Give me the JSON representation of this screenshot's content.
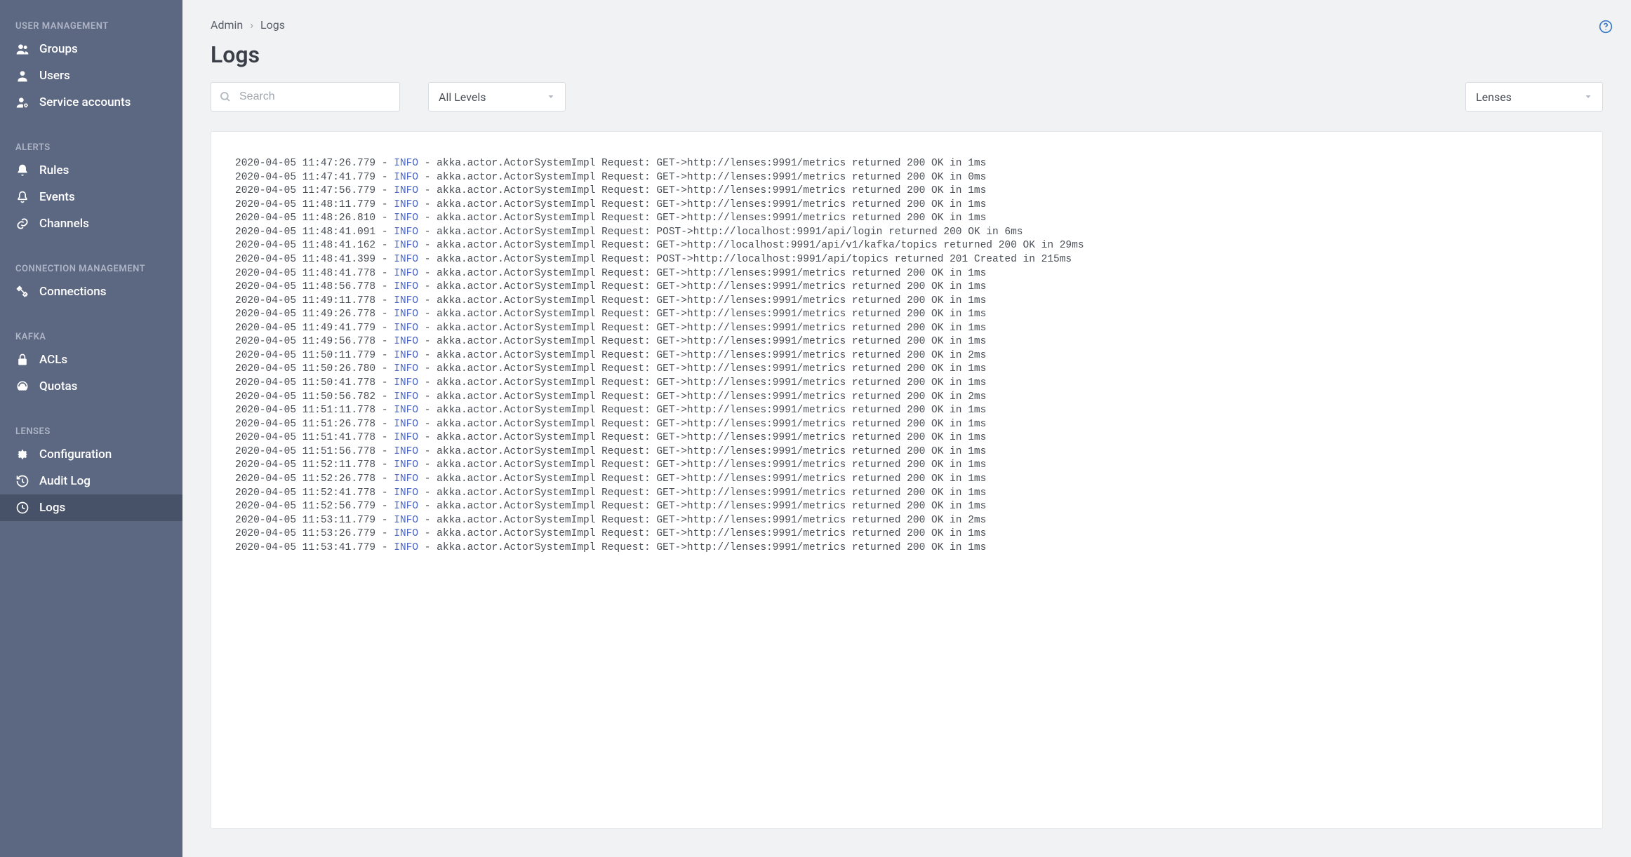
{
  "sidebar": {
    "sections": [
      {
        "title": "USER MANAGEMENT",
        "items": [
          {
            "label": "Groups",
            "icon": "users-icon"
          },
          {
            "label": "Users",
            "icon": "user-icon"
          },
          {
            "label": "Service accounts",
            "icon": "user-gear-icon"
          }
        ]
      },
      {
        "title": "ALERTS",
        "items": [
          {
            "label": "Rules",
            "icon": "bell-solid-icon"
          },
          {
            "label": "Events",
            "icon": "bell-outline-icon"
          },
          {
            "label": "Channels",
            "icon": "link-icon"
          }
        ]
      },
      {
        "title": "CONNECTION MANAGEMENT",
        "items": [
          {
            "label": "Connections",
            "icon": "plug-icon"
          }
        ]
      },
      {
        "title": "KAFKA",
        "items": [
          {
            "label": "ACLs",
            "icon": "lock-icon"
          },
          {
            "label": "Quotas",
            "icon": "dashboard-icon"
          }
        ]
      },
      {
        "title": "LENSES",
        "items": [
          {
            "label": "Configuration",
            "icon": "gear-icon"
          },
          {
            "label": "Audit Log",
            "icon": "history-icon"
          },
          {
            "label": "Logs",
            "icon": "clock-icon",
            "active": true
          }
        ]
      }
    ]
  },
  "breadcrumb": {
    "root": "Admin",
    "current": "Logs"
  },
  "page_title": "Logs",
  "search": {
    "placeholder": "Search"
  },
  "level_select": {
    "selected": "All Levels"
  },
  "source_select": {
    "selected": "Lenses"
  },
  "log_level_color": "#4a66c7",
  "logs": [
    {
      "ts": "2020-04-05 11:47:26.779",
      "level": "INFO",
      "msg": "akka.actor.ActorSystemImpl Request: GET->http://lenses:9991/metrics returned 200 OK in 1ms"
    },
    {
      "ts": "2020-04-05 11:47:41.779",
      "level": "INFO",
      "msg": "akka.actor.ActorSystemImpl Request: GET->http://lenses:9991/metrics returned 200 OK in 0ms"
    },
    {
      "ts": "2020-04-05 11:47:56.779",
      "level": "INFO",
      "msg": "akka.actor.ActorSystemImpl Request: GET->http://lenses:9991/metrics returned 200 OK in 1ms"
    },
    {
      "ts": "2020-04-05 11:48:11.779",
      "level": "INFO",
      "msg": "akka.actor.ActorSystemImpl Request: GET->http://lenses:9991/metrics returned 200 OK in 1ms"
    },
    {
      "ts": "2020-04-05 11:48:26.810",
      "level": "INFO",
      "msg": "akka.actor.ActorSystemImpl Request: GET->http://lenses:9991/metrics returned 200 OK in 1ms"
    },
    {
      "ts": "2020-04-05 11:48:41.091",
      "level": "INFO",
      "msg": "akka.actor.ActorSystemImpl Request: POST->http://localhost:9991/api/login returned 200 OK in 6ms"
    },
    {
      "ts": "2020-04-05 11:48:41.162",
      "level": "INFO",
      "msg": "akka.actor.ActorSystemImpl Request: GET->http://localhost:9991/api/v1/kafka/topics returned 200 OK in 29ms"
    },
    {
      "ts": "2020-04-05 11:48:41.399",
      "level": "INFO",
      "msg": "akka.actor.ActorSystemImpl Request: POST->http://localhost:9991/api/topics returned 201 Created in 215ms"
    },
    {
      "ts": "2020-04-05 11:48:41.778",
      "level": "INFO",
      "msg": "akka.actor.ActorSystemImpl Request: GET->http://lenses:9991/metrics returned 200 OK in 1ms"
    },
    {
      "ts": "2020-04-05 11:48:56.778",
      "level": "INFO",
      "msg": "akka.actor.ActorSystemImpl Request: GET->http://lenses:9991/metrics returned 200 OK in 1ms"
    },
    {
      "ts": "2020-04-05 11:49:11.778",
      "level": "INFO",
      "msg": "akka.actor.ActorSystemImpl Request: GET->http://lenses:9991/metrics returned 200 OK in 1ms"
    },
    {
      "ts": "2020-04-05 11:49:26.778",
      "level": "INFO",
      "msg": "akka.actor.ActorSystemImpl Request: GET->http://lenses:9991/metrics returned 200 OK in 1ms"
    },
    {
      "ts": "2020-04-05 11:49:41.779",
      "level": "INFO",
      "msg": "akka.actor.ActorSystemImpl Request: GET->http://lenses:9991/metrics returned 200 OK in 1ms"
    },
    {
      "ts": "2020-04-05 11:49:56.778",
      "level": "INFO",
      "msg": "akka.actor.ActorSystemImpl Request: GET->http://lenses:9991/metrics returned 200 OK in 1ms"
    },
    {
      "ts": "2020-04-05 11:50:11.779",
      "level": "INFO",
      "msg": "akka.actor.ActorSystemImpl Request: GET->http://lenses:9991/metrics returned 200 OK in 2ms"
    },
    {
      "ts": "2020-04-05 11:50:26.780",
      "level": "INFO",
      "msg": "akka.actor.ActorSystemImpl Request: GET->http://lenses:9991/metrics returned 200 OK in 1ms"
    },
    {
      "ts": "2020-04-05 11:50:41.778",
      "level": "INFO",
      "msg": "akka.actor.ActorSystemImpl Request: GET->http://lenses:9991/metrics returned 200 OK in 1ms"
    },
    {
      "ts": "2020-04-05 11:50:56.782",
      "level": "INFO",
      "msg": "akka.actor.ActorSystemImpl Request: GET->http://lenses:9991/metrics returned 200 OK in 2ms"
    },
    {
      "ts": "2020-04-05 11:51:11.778",
      "level": "INFO",
      "msg": "akka.actor.ActorSystemImpl Request: GET->http://lenses:9991/metrics returned 200 OK in 1ms"
    },
    {
      "ts": "2020-04-05 11:51:26.778",
      "level": "INFO",
      "msg": "akka.actor.ActorSystemImpl Request: GET->http://lenses:9991/metrics returned 200 OK in 1ms"
    },
    {
      "ts": "2020-04-05 11:51:41.778",
      "level": "INFO",
      "msg": "akka.actor.ActorSystemImpl Request: GET->http://lenses:9991/metrics returned 200 OK in 1ms"
    },
    {
      "ts": "2020-04-05 11:51:56.778",
      "level": "INFO",
      "msg": "akka.actor.ActorSystemImpl Request: GET->http://lenses:9991/metrics returned 200 OK in 1ms"
    },
    {
      "ts": "2020-04-05 11:52:11.778",
      "level": "INFO",
      "msg": "akka.actor.ActorSystemImpl Request: GET->http://lenses:9991/metrics returned 200 OK in 1ms"
    },
    {
      "ts": "2020-04-05 11:52:26.778",
      "level": "INFO",
      "msg": "akka.actor.ActorSystemImpl Request: GET->http://lenses:9991/metrics returned 200 OK in 1ms"
    },
    {
      "ts": "2020-04-05 11:52:41.778",
      "level": "INFO",
      "msg": "akka.actor.ActorSystemImpl Request: GET->http://lenses:9991/metrics returned 200 OK in 1ms"
    },
    {
      "ts": "2020-04-05 11:52:56.779",
      "level": "INFO",
      "msg": "akka.actor.ActorSystemImpl Request: GET->http://lenses:9991/metrics returned 200 OK in 1ms"
    },
    {
      "ts": "2020-04-05 11:53:11.779",
      "level": "INFO",
      "msg": "akka.actor.ActorSystemImpl Request: GET->http://lenses:9991/metrics returned 200 OK in 2ms"
    },
    {
      "ts": "2020-04-05 11:53:26.779",
      "level": "INFO",
      "msg": "akka.actor.ActorSystemImpl Request: GET->http://lenses:9991/metrics returned 200 OK in 1ms"
    },
    {
      "ts": "2020-04-05 11:53:41.779",
      "level": "INFO",
      "msg": "akka.actor.ActorSystemImpl Request: GET->http://lenses:9991/metrics returned 200 OK in 1ms"
    }
  ]
}
